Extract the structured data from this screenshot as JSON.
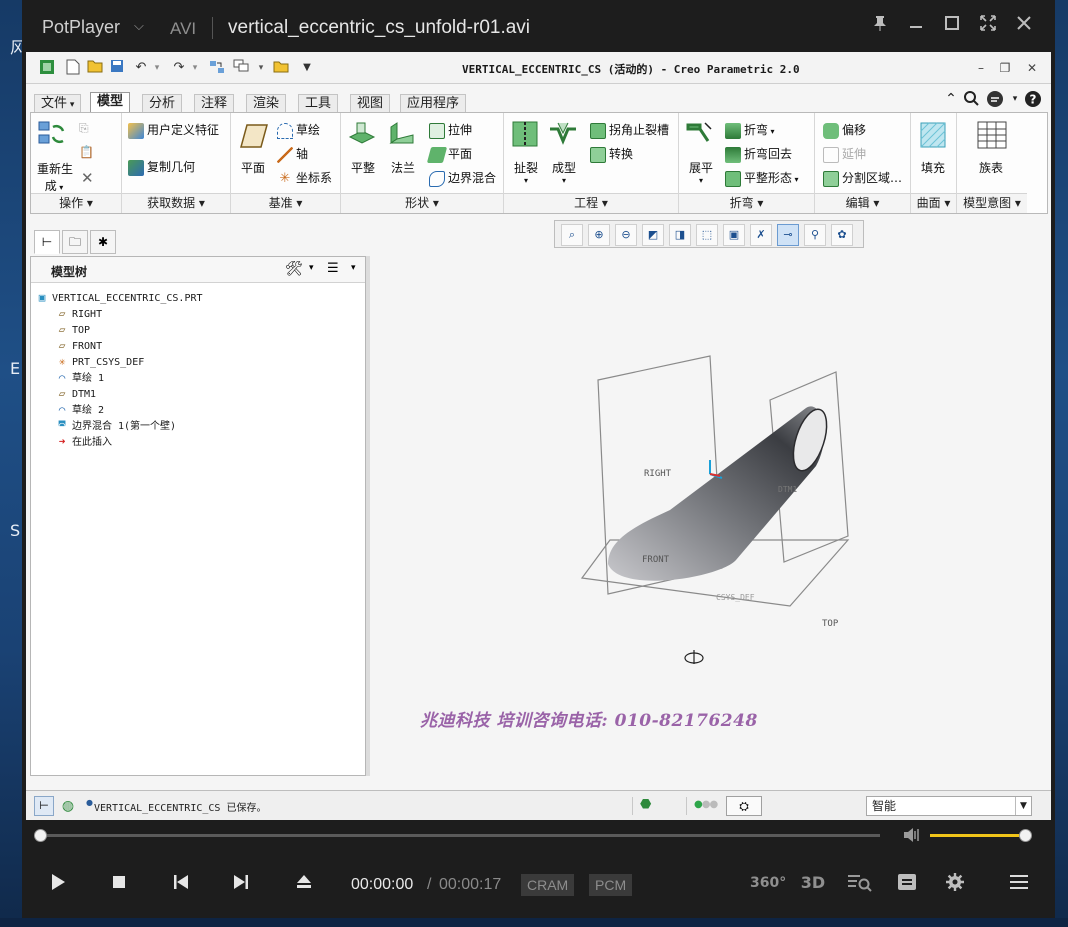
{
  "desktop": {
    "letters": [
      "风",
      "E",
      "S"
    ]
  },
  "player": {
    "brand": "PotPlayer",
    "format": "AVI",
    "file": "vertical_eccentric_cs_unfold-r01.avi",
    "time_current": "00:00:00",
    "time_sep": "/",
    "time_total": "00:00:17",
    "badge_video": "CRAM",
    "badge_audio": "PCM",
    "seek_fraction": 0.0,
    "volume_fraction": 1.0,
    "btn_360": "360°",
    "btn_3d": "3D"
  },
  "creo": {
    "title": "VERTICAL_ECCENTRIC_CS (活动的) - Creo Parametric 2.0",
    "tabs": [
      "文件",
      "模型",
      "分析",
      "注释",
      "渲染",
      "工具",
      "视图",
      "应用程序"
    ],
    "active_tab": "模型",
    "ribbon": {
      "operations": {
        "regen_l1": "重新生",
        "regen_l2": "成",
        "label": "操作"
      },
      "getdata": {
        "udf": "用户定义特征",
        "copygeom": "复制几何",
        "label": "获取数据"
      },
      "datum": {
        "plane": "平面",
        "sketch": "草绘",
        "axis": "轴",
        "csys": "坐标系",
        "label": "基准"
      },
      "shape": {
        "flat": "平整",
        "flange": "法兰",
        "extrude": "拉伸",
        "planar": "平面",
        "blend": "边界混合",
        "label": "形状"
      },
      "engineering": {
        "rip": "扯裂",
        "form": "成型",
        "corner_relief": "拐角止裂槽",
        "convert": "转换",
        "label": "工程"
      },
      "bend": {
        "unbend": "展平",
        "bend": "折弯",
        "bendback": "折弯回去",
        "flatpattern": "平整形态",
        "label": "折弯"
      },
      "editing": {
        "offset": "偏移",
        "extend": "延伸",
        "split": "分割区域…",
        "label": "编辑"
      },
      "surfaces": {
        "fill": "填充",
        "label": "曲面"
      },
      "intent": {
        "family": "族表",
        "label": "模型意图"
      }
    },
    "tree": {
      "title": "模型树",
      "items": [
        {
          "icon": "part-icon",
          "label": "VERTICAL_ECCENTRIC_CS.PRT"
        },
        {
          "icon": "datum-plane-icon",
          "label": "RIGHT"
        },
        {
          "icon": "datum-plane-icon",
          "label": "TOP"
        },
        {
          "icon": "datum-plane-icon",
          "label": "FRONT"
        },
        {
          "icon": "csys-icon",
          "label": "PRT_CSYS_DEF"
        },
        {
          "icon": "sketch-icon",
          "label": "草绘 1"
        },
        {
          "icon": "datum-plane-icon",
          "label": "DTM1"
        },
        {
          "icon": "sketch-icon",
          "label": "草绘 2"
        },
        {
          "icon": "blend-icon",
          "label": "边界混合 1(第一个壁)"
        },
        {
          "icon": "insert-here-icon",
          "label": "在此插入"
        }
      ]
    },
    "graphics": {
      "labels": {
        "right": "RIGHT",
        "front": "FRONT",
        "top": "TOP",
        "dtm": "DTM1",
        "csys": "CSYS_DEF"
      }
    },
    "watermark": "兆迪科技 培训咨询电话: 010-82176248",
    "status": {
      "message": "VERTICAL_ECCENTRIC_CS 已保存。",
      "filter": "智能"
    },
    "colors": {
      "watermark": "#9a63a8",
      "accent": "#1c4f8f"
    }
  }
}
